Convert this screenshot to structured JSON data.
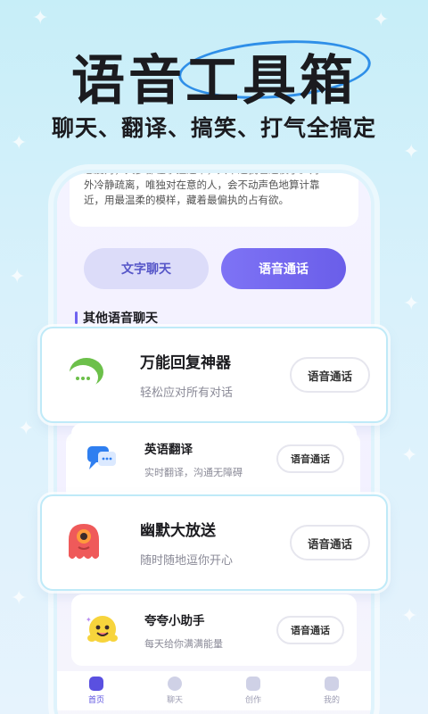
{
  "header": {
    "title": "语音工具箱",
    "subtitle": "聊天、翻译、搞笑、打气全搞定"
  },
  "intro": {
    "lines": [
      "恋爱对，大多都在掌控之中，只不过我也过惯了。对",
      "外冷静疏离，唯独对在意的人，会不动声色地算计靠",
      "近，用最温柔的模样，藏着最偏执的占有欲。"
    ]
  },
  "modes": {
    "text_chat": "文字聊天",
    "voice_call": "语音通话"
  },
  "section": {
    "title": "其他语音聊天"
  },
  "cards": [
    {
      "title": "万能回复神器",
      "desc": "轻松应对所有对话",
      "button": "语音通话",
      "icon": "green-chat-bubble-icon"
    },
    {
      "title": "英语翻译",
      "desc": "实时翻译，沟通无障碍",
      "button": "语音通话",
      "icon": "blue-chat-bubble-icon"
    },
    {
      "title": "幽默大放送",
      "desc": "随时随地逗你开心",
      "button": "语音通话",
      "icon": "red-cyclops-icon"
    },
    {
      "title": "夸夸小助手",
      "desc": "每天给你满满能量",
      "button": "语音通话",
      "icon": "yellow-smiley-icon"
    }
  ],
  "nav": [
    {
      "label": "首页",
      "active": true
    },
    {
      "label": "聊天",
      "active": false
    },
    {
      "label": "创作",
      "active": false
    },
    {
      "label": "我的",
      "active": false
    }
  ],
  "colors": {
    "accent": "#6a5ee9",
    "title_ellipse": "#2f8fe8",
    "background": "#c7eef8"
  }
}
